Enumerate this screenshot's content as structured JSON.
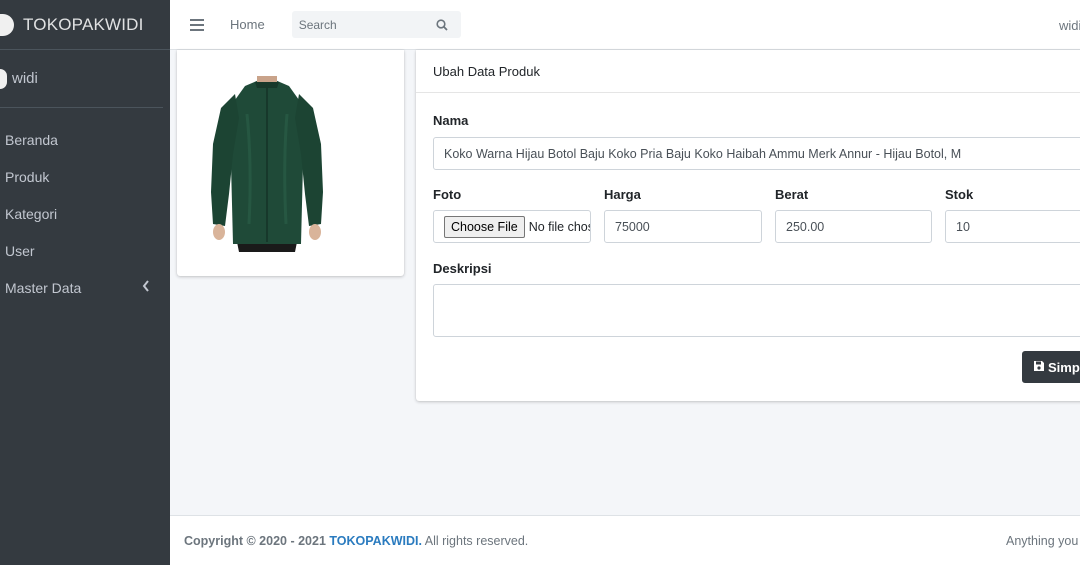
{
  "brand": {
    "name": "TOKOPAKWIDI"
  },
  "user": {
    "name": "widi"
  },
  "sidebar": {
    "items": [
      {
        "label": "Beranda"
      },
      {
        "label": "Produk"
      },
      {
        "label": "Kategori"
      },
      {
        "label": "User"
      },
      {
        "label": "Master Data"
      }
    ]
  },
  "header": {
    "home_label": "Home",
    "search_placeholder": "Search",
    "user_label": "widi"
  },
  "form": {
    "title": "Ubah Data Produk",
    "nama_label": "Nama",
    "nama_value": "Koko Warna Hijau Botol Baju Koko Pria Baju Koko Haibah Ammu Merk Annur - Hijau Botol, M",
    "foto_label": "Foto",
    "file_button": "Choose File",
    "file_status": "No file chosen",
    "harga_label": "Harga",
    "harga_value": "75000",
    "berat_label": "Berat",
    "berat_value": "250.00",
    "stok_label": "Stok",
    "stok_value": "10",
    "deskripsi_label": "Deskripsi",
    "deskripsi_value": "",
    "save_label": "Simpan"
  },
  "footer": {
    "copyright_prefix": "Copyright © 2020 - 2021 ",
    "brand": "TOKOPAKWIDI.",
    "rights": " All rights reserved.",
    "right_text": "Anything you want"
  },
  "colors": {
    "sidebar_bg": "#343a40",
    "link_blue": "#2a7bbf",
    "shirt_green": "#1f4a38"
  }
}
